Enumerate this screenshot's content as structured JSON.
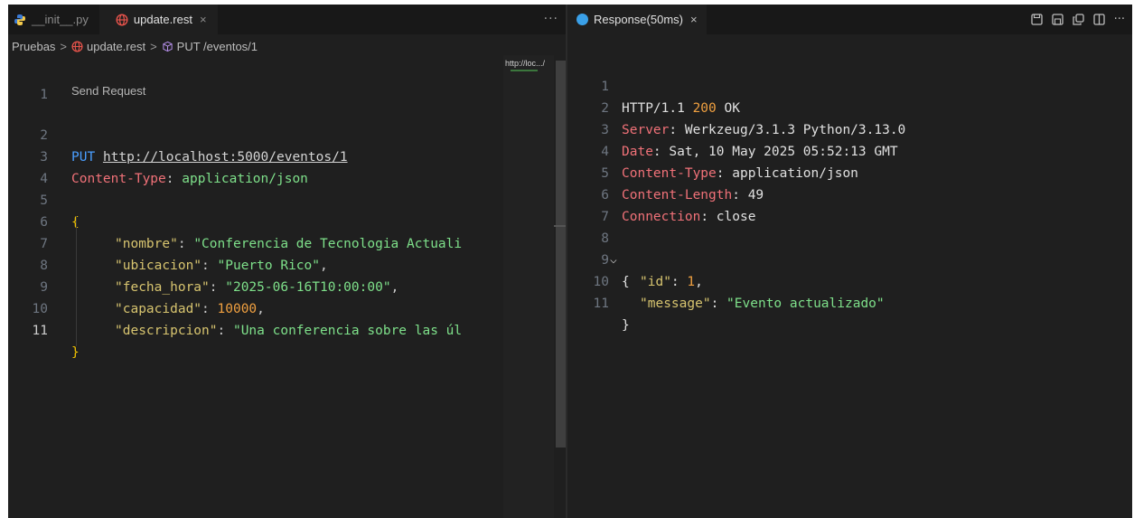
{
  "left_tabs": [
    {
      "label": "__init__.py",
      "active": false
    },
    {
      "label": "update.rest",
      "active": true
    }
  ],
  "tab_close": "×",
  "tab_more": "···",
  "breadcrumb": {
    "folder": "Pruebas",
    "file": "update.rest",
    "symbol": "PUT /eventos/1",
    "sep": ">"
  },
  "codelens": "Send Request",
  "editor_lines": {
    "n1": "1",
    "n2": "2",
    "n3": "3",
    "n4": "4",
    "n5": "5",
    "n6": "6",
    "n7": "7",
    "n8": "8",
    "n9": "9",
    "n10": "10",
    "n11": "11",
    "method": "PUT",
    "url": "http://localhost:5000/eventos/1",
    "header_name": "Content-Type",
    "header_sep": ": ",
    "header_value": "application/json",
    "open_brace": "{",
    "close_brace": "}",
    "k_nombre": "\"nombre\"",
    "v_nombre": "\"Conferencia de Tecnologia Actuali",
    "k_ubicacion": "\"ubicacion\"",
    "v_ubicacion": "\"Puerto Rico\"",
    "k_fecha": "\"fecha_hora\"",
    "v_fecha": "\"2025-06-16T10:00:00\"",
    "k_capacidad": "\"capacidad\"",
    "v_capacidad": "10000",
    "k_descripcion": "\"descripcion\"",
    "v_descripcion": "\"Una conferencia sobre las úl",
    "colon": ": ",
    "comma": ","
  },
  "minimap_title": "http://loc.../",
  "response_tab": {
    "label": "Response(50ms)",
    "close": "×"
  },
  "response_lines": {
    "n1": "1",
    "n2": "2",
    "n3": "3",
    "n4": "4",
    "n5": "5",
    "n6": "6",
    "n7": "7",
    "n8": "8",
    "n9": "9",
    "n10": "10",
    "n11": "11",
    "status_proto": "HTTP/1.1 ",
    "status_code": "200",
    "status_text": " OK",
    "server_key": "Server",
    "server_val": "Werkzeug/3.1.3 Python/3.13.0",
    "date_key": "Date",
    "date_val": "Sat, 10 May 2025 05:52:13 GMT",
    "ctype_key": "Content-Type",
    "ctype_val": "application/json",
    "clen_key": "Content-Length",
    "clen_val": "49",
    "conn_key": "Connection",
    "conn_val": "close",
    "open_brace": "{",
    "close_brace": "}",
    "k_id": "\"id\"",
    "v_id": "1",
    "k_message": "\"message\"",
    "v_message": "\"Evento actualizado\"",
    "colon": ": ",
    "comma": ",",
    "fold_marker": "⌵"
  },
  "actions_more": "···"
}
